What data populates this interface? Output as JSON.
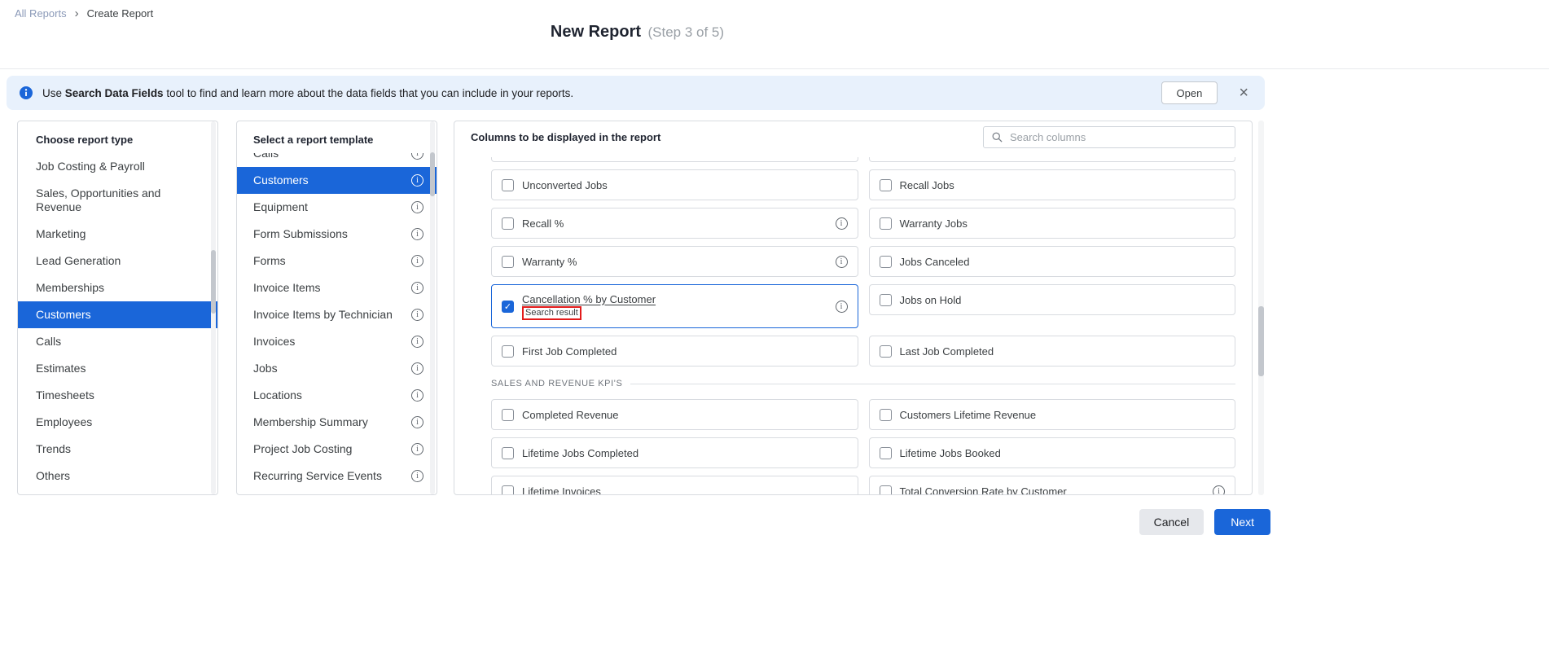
{
  "colors": {
    "accent": "#1a66d9",
    "banner_bg": "#e8f1fc",
    "annotation_red": "#e21b1b",
    "breadcrumb_link": "#8b9ab8"
  },
  "breadcrumb": {
    "all_reports": "All Reports",
    "separator": "›",
    "create_report": "Create Report"
  },
  "header": {
    "title": "New Report",
    "step": "(Step 3 of 5)"
  },
  "banner": {
    "text_before": "Use ",
    "text_bold": "Search Data Fields",
    "text_after": " tool to find and learn more about the data fields that you can include in your reports.",
    "open_label": "Open",
    "close_label": "×"
  },
  "report_types": {
    "title": "Choose report type",
    "items": [
      {
        "label": "Job Costing & Payroll"
      },
      {
        "label": "Sales, Opportunities and Revenue"
      },
      {
        "label": "Marketing"
      },
      {
        "label": "Lead Generation"
      },
      {
        "label": "Memberships"
      },
      {
        "label": "Customers",
        "selected": true
      },
      {
        "label": "Calls"
      },
      {
        "label": "Estimates"
      },
      {
        "label": "Timesheets"
      },
      {
        "label": "Employees"
      },
      {
        "label": "Trends"
      },
      {
        "label": "Others"
      }
    ]
  },
  "templates": {
    "title": "Select a report template",
    "items": [
      {
        "label": "Calls"
      },
      {
        "label": "Customers",
        "selected": true
      },
      {
        "label": "Equipment"
      },
      {
        "label": "Form Submissions"
      },
      {
        "label": "Forms"
      },
      {
        "label": "Invoice Items"
      },
      {
        "label": "Invoice Items by Technician"
      },
      {
        "label": "Invoices"
      },
      {
        "label": "Jobs"
      },
      {
        "label": "Locations"
      },
      {
        "label": "Membership Summary"
      },
      {
        "label": "Project Job Costing"
      },
      {
        "label": "Recurring Service Events"
      }
    ]
  },
  "columns": {
    "title": "Columns to be displayed in the report",
    "search_placeholder": "Search columns",
    "section_label": "SALES AND REVENUE KPI'S",
    "selected_badge": "Search result",
    "left": [
      {
        "label": "Unconverted Jobs"
      },
      {
        "label": "Recall %",
        "info": true
      },
      {
        "label": "Warranty %",
        "info": true
      },
      {
        "label": "Cancellation % by Customer",
        "info": true,
        "checked": true
      },
      {
        "label": "First Job Completed"
      },
      {
        "label": "Completed Revenue"
      },
      {
        "label": "Lifetime Jobs Completed"
      },
      {
        "label": "Lifetime Invoices"
      }
    ],
    "right": [
      {
        "label": "Recall Jobs"
      },
      {
        "label": "Warranty Jobs"
      },
      {
        "label": "Jobs Canceled"
      },
      {
        "label": "Jobs on Hold"
      },
      {
        "label": "Last Job Completed"
      },
      {
        "label": "Customers Lifetime Revenue"
      },
      {
        "label": "Lifetime Jobs Booked"
      },
      {
        "label": "Total Conversion Rate by Customer",
        "info": true
      }
    ]
  },
  "footer": {
    "cancel": "Cancel",
    "next": "Next"
  }
}
